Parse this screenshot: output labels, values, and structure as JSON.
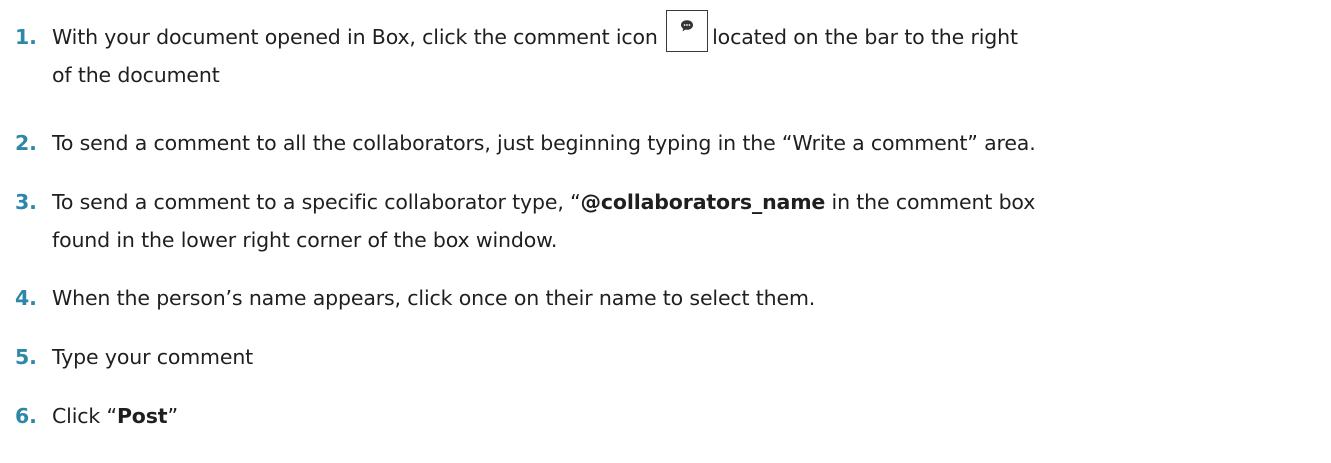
{
  "steps": [
    {
      "number": "1.",
      "text_before_icon": "With your document opened in Box, click the comment icon",
      "text_after_icon": "located on the bar to the right",
      "continuation": "of the document",
      "icon": "comment-icon"
    },
    {
      "number": "2.",
      "text": "To send a comment to all the collaborators, just beginning typing in the “Write a comment” area."
    },
    {
      "number": "3.",
      "text_before_bold": "To send a comment to a specific collaborator type, “",
      "bold": "@collaborators_name",
      "text_after_bold": " in the comment box",
      "continuation": "found in the lower right corner of the box window."
    },
    {
      "number": "4.",
      "text": "When the person’s name appears, click once on their name to select them."
    },
    {
      "number": "5.",
      "text": "Type your comment"
    },
    {
      "number": "6.",
      "text_before_bold": "Click “",
      "bold": "Post",
      "text_after_bold": "”"
    }
  ],
  "colors": {
    "step_number": "#2e86a8",
    "body_text": "#1f1f1f"
  }
}
